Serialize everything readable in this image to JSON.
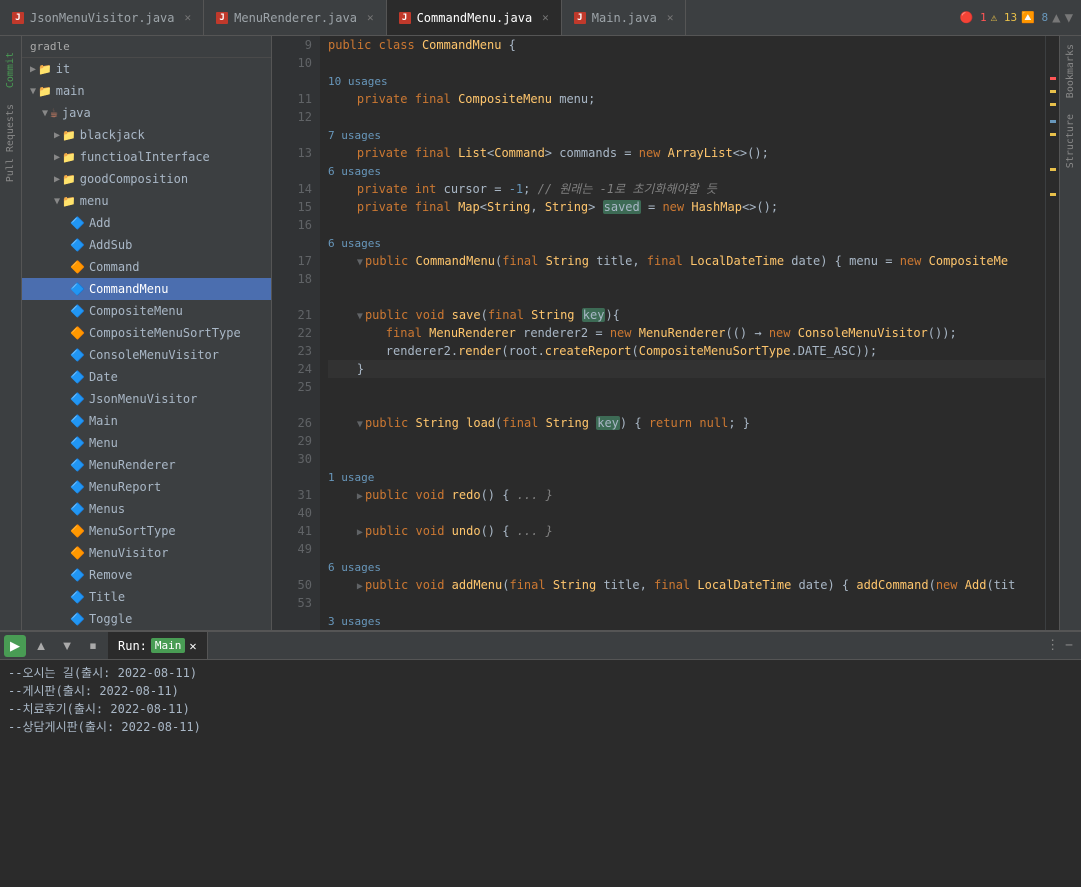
{
  "tabs": [
    {
      "id": "json-menu-visitor",
      "label": "JsonMenuVisitor.java",
      "active": false,
      "type": "java"
    },
    {
      "id": "menu-renderer",
      "label": "MenuRenderer.java",
      "active": false,
      "type": "java"
    },
    {
      "id": "command-menu",
      "label": "CommandMenu.java",
      "active": true,
      "type": "java"
    },
    {
      "id": "main",
      "label": "Main.java",
      "active": false,
      "type": "java"
    }
  ],
  "badges": {
    "errors": "1",
    "warnings": "13",
    "info": "8"
  },
  "project_tree": {
    "root_label": "gradle",
    "items": [
      {
        "id": "it",
        "label": "it",
        "level": 1,
        "type": "folder",
        "open": false
      },
      {
        "id": "main",
        "label": "main",
        "level": 1,
        "type": "folder",
        "open": true,
        "active": false
      },
      {
        "id": "java",
        "label": "java",
        "level": 2,
        "type": "pkg",
        "open": true
      },
      {
        "id": "blackjack",
        "label": "blackjack",
        "level": 3,
        "type": "folder",
        "open": false
      },
      {
        "id": "functionalInterface",
        "label": "functioalInterface",
        "level": 3,
        "type": "folder",
        "open": false
      },
      {
        "id": "goodComposition",
        "label": "goodComposition",
        "level": 3,
        "type": "folder",
        "open": false
      },
      {
        "id": "menu",
        "label": "menu",
        "level": 3,
        "type": "folder",
        "open": true
      },
      {
        "id": "Add",
        "label": "Add",
        "level": 4,
        "type": "class",
        "open": false
      },
      {
        "id": "AddSub",
        "label": "AddSub",
        "level": 4,
        "type": "class",
        "open": false
      },
      {
        "id": "Command",
        "label": "Command",
        "level": 4,
        "type": "interface",
        "open": false
      },
      {
        "id": "CommandMenu",
        "label": "CommandMenu",
        "level": 4,
        "type": "class",
        "open": false,
        "selected": true
      },
      {
        "id": "CompositeMenu",
        "label": "CompositeMenu",
        "level": 4,
        "type": "class",
        "open": false
      },
      {
        "id": "CompositeMenuSortType",
        "label": "CompositeMenuSortType",
        "level": 4,
        "type": "enum",
        "open": false
      },
      {
        "id": "ConsoleMenuVisitor",
        "label": "ConsoleMenuVisitor",
        "level": 4,
        "type": "class",
        "open": false
      },
      {
        "id": "Date",
        "label": "Date",
        "level": 4,
        "type": "class",
        "open": false
      },
      {
        "id": "JsonMenuVisitor",
        "label": "JsonMenuVisitor",
        "level": 4,
        "type": "class",
        "open": false
      },
      {
        "id": "Main",
        "label": "Main",
        "level": 4,
        "type": "class",
        "open": false
      },
      {
        "id": "Menu",
        "label": "Menu",
        "level": 4,
        "type": "class",
        "open": false
      },
      {
        "id": "MenuRenderer",
        "label": "MenuRenderer",
        "level": 4,
        "type": "class",
        "open": false
      },
      {
        "id": "MenuReport",
        "label": "MenuReport",
        "level": 4,
        "type": "class",
        "open": false
      },
      {
        "id": "Menus",
        "label": "Menus",
        "level": 4,
        "type": "class",
        "open": false
      },
      {
        "id": "MenuSortType",
        "label": "MenuSortType",
        "level": 4,
        "type": "enum",
        "open": false
      },
      {
        "id": "MenuVisitor",
        "label": "MenuVisitor",
        "level": 4,
        "type": "interface",
        "open": false
      },
      {
        "id": "Remove",
        "label": "Remove",
        "level": 4,
        "type": "class",
        "open": false
      },
      {
        "id": "Title",
        "label": "Title",
        "level": 4,
        "type": "class",
        "open": false
      },
      {
        "id": "Toggle",
        "label": "Toggle",
        "level": 4,
        "type": "class",
        "open": false
      }
    ]
  },
  "code_lines": [
    {
      "num": 9,
      "content": "public class CommandMenu {",
      "type": "normal"
    },
    {
      "num": 10,
      "content": "",
      "type": "normal"
    },
    {
      "num": "",
      "content": "10 usages",
      "type": "usage"
    },
    {
      "num": 11,
      "content": "    private final CompositeMenu menu;",
      "type": "normal"
    },
    {
      "num": 12,
      "content": "",
      "type": "normal"
    },
    {
      "num": "",
      "content": "7 usages",
      "type": "usage"
    },
    {
      "num": 13,
      "content": "    private final List<Command> commands = new ArrayList<>();",
      "type": "normal"
    },
    {
      "num": "",
      "content": "6 usages",
      "type": "usage"
    },
    {
      "num": 14,
      "content": "    private int cursor = -1; // 원래는 -1로 초기화해야할 듯",
      "type": "normal"
    },
    {
      "num": 15,
      "content": "    private final Map<String, String> saved = new HashMap<>();",
      "type": "normal"
    },
    {
      "num": 16,
      "content": "",
      "type": "normal"
    },
    {
      "num": "",
      "content": "6 usages",
      "type": "usage"
    },
    {
      "num": 17,
      "content": "    public CommandMenu(final String title, final LocalDateTime date) { menu = new CompositeMe",
      "type": "normal"
    },
    {
      "num": 18,
      "content": "",
      "type": "normal"
    },
    {
      "num": 21,
      "content": "    public void save(final String key){",
      "type": "normal"
    },
    {
      "num": 22,
      "content": "        final MenuRenderer renderer2 = new MenuRenderer(() -> new ConsoleMenuVisitor());",
      "type": "normal"
    },
    {
      "num": 23,
      "content": "        renderer2.render(root.createReport(CompositeMenuSortType.DATE_ASC));",
      "type": "normal"
    },
    {
      "num": 24,
      "content": "    }",
      "type": "normal",
      "active": true
    },
    {
      "num": 25,
      "content": "",
      "type": "normal"
    },
    {
      "num": "",
      "content": "",
      "type": "normal"
    },
    {
      "num": 26,
      "content": "    public String load(final String key) { return null; }",
      "type": "normal"
    },
    {
      "num": 29,
      "content": "",
      "type": "normal"
    },
    {
      "num": 30,
      "content": "",
      "type": "normal"
    },
    {
      "num": "",
      "content": "1 usage",
      "type": "usage"
    },
    {
      "num": 31,
      "content": "    public void redo() { ... }",
      "type": "normal"
    },
    {
      "num": 40,
      "content": "",
      "type": "normal"
    },
    {
      "num": 41,
      "content": "    public void undo() { ... }",
      "type": "normal"
    },
    {
      "num": 49,
      "content": "",
      "type": "normal"
    },
    {
      "num": "",
      "content": "6 usages",
      "type": "usage"
    },
    {
      "num": 50,
      "content": "    public void addMenu(final String title, final LocalDateTime date) { addCommand(new Add(tit",
      "type": "normal"
    },
    {
      "num": 53,
      "content": "",
      "type": "normal"
    },
    {
      "num": "",
      "content": "3 usages",
      "type": "usage"
    }
  ],
  "bottom_panel": {
    "tab_label": "Run:",
    "run_config": "Main",
    "output_lines": [
      "--오시는 길(출시: 2022-08-11)",
      "--게시판(출시: 2022-08-11)",
      "--치료후기(출시: 2022-08-11)",
      "--상담게시판(출시: 2022-08-11)"
    ]
  },
  "side_labels": [
    "Structure",
    "Bookmarks",
    "Pull Requests",
    "Commit"
  ],
  "icons": {
    "play": "▶",
    "up": "▲",
    "down": "▼",
    "menu": "⋮",
    "close": "✕",
    "minimize": "−",
    "fold_open": "▼",
    "fold_closed": "▶",
    "folder": "📁",
    "error": "🔴",
    "warning": "⚠",
    "info": "ℹ"
  }
}
